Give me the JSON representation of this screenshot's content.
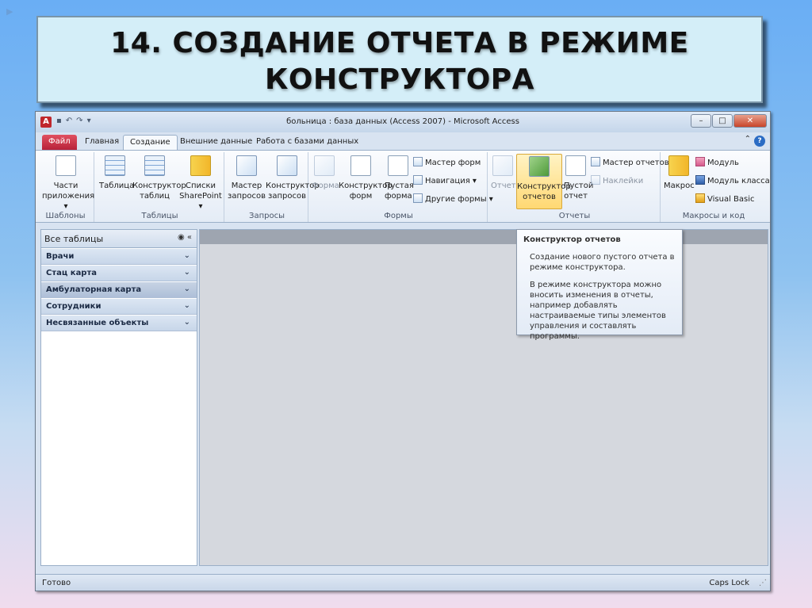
{
  "slide": {
    "title_line1": "14. СОЗДАНИЕ ОТЧЕТА В РЕЖИМЕ",
    "title_line2": "КОНСТРУКТОРА"
  },
  "window": {
    "title": "больница : база данных (Access 2007)  -  Microsoft Access",
    "app_icon": "A",
    "minimize": "–",
    "maximize": "□",
    "close": "✕"
  },
  "tabs": {
    "file": "Файл",
    "home": "Главная",
    "create": "Создание",
    "external": "Внешние данные",
    "database": "Работа с базами данных"
  },
  "ribbon": {
    "templates": {
      "label": "Шаблоны",
      "parts": "Части приложения ▾"
    },
    "tables": {
      "label": "Таблицы",
      "table": "Таблица",
      "designer": "Конструктор таблиц",
      "sharepoint": "Списки SharePoint ▾"
    },
    "queries": {
      "label": "Запросы",
      "wizard": "Мастер запросов",
      "designer": "Конструктор запросов"
    },
    "forms": {
      "label": "Формы",
      "form": "Форма",
      "designer": "Конструктор форм",
      "blank": "Пустая форма",
      "wizard": "Мастер форм",
      "navigation": "Навигация ▾",
      "other": "Другие формы ▾"
    },
    "reports": {
      "label": "Отчеты",
      "report": "Отчет",
      "designer": "Конструктор отчетов",
      "blank": "Пустой отчет",
      "wizard": "Мастер отчетов",
      "labels": "Наклейки"
    },
    "macros": {
      "label": "Макросы и код",
      "macro": "Макрос",
      "module": "Модуль",
      "class_module": "Модуль класса",
      "vb": "Visual Basic"
    }
  },
  "nav": {
    "header": "Все таблицы",
    "groups": [
      "Врачи",
      "Стац карта",
      "Амбулаторная карта",
      "Сотрудники",
      "Несвязанные объекты"
    ]
  },
  "tooltip": {
    "title": "Конструктор отчетов",
    "p1": "Создание нового пустого отчета в режиме конструктора.",
    "p2": "В режиме конструктора можно вносить изменения в отчеты, например добавлять настраиваемые типы элементов управления и составлять программы."
  },
  "status": {
    "left": "Готово",
    "right": "Caps Lock"
  }
}
